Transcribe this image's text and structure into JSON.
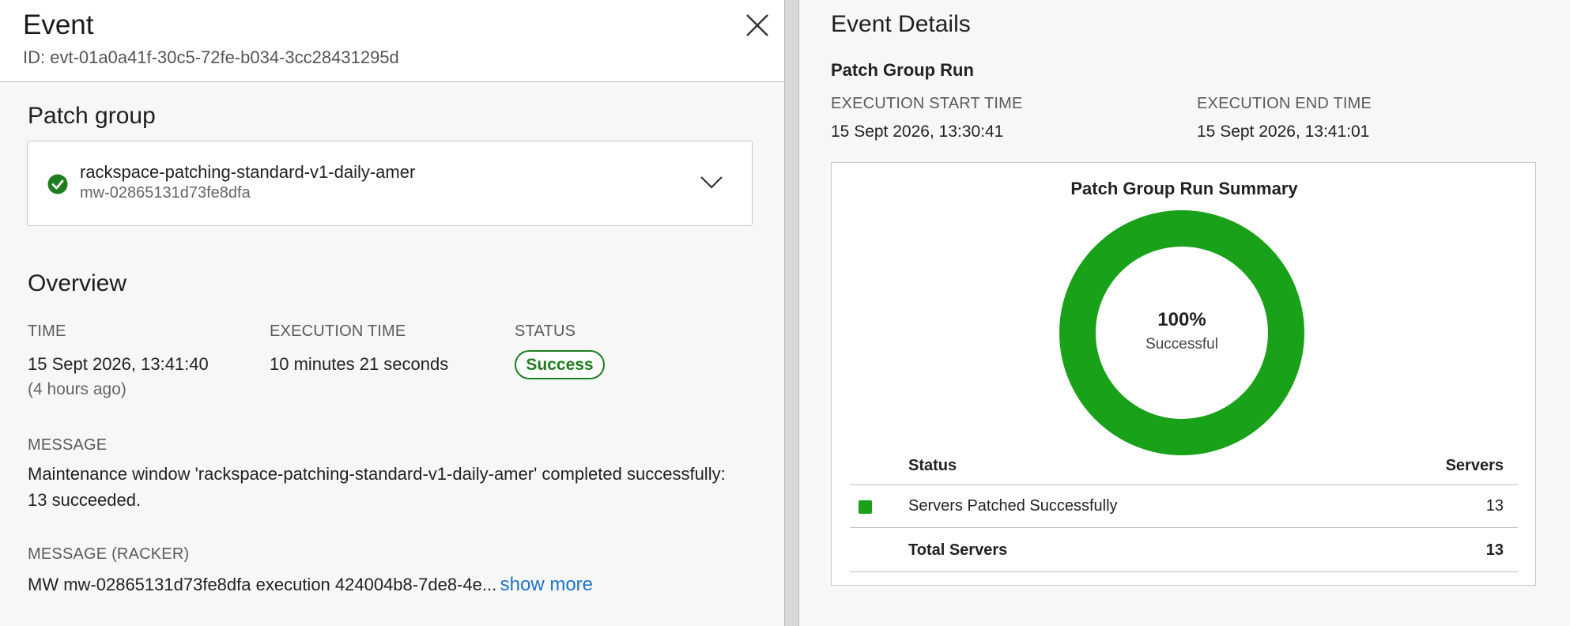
{
  "event": {
    "title": "Event",
    "id_text": "ID: evt-01a0a41f-30c5-72fe-b034-3cc28431295d"
  },
  "patch_group": {
    "section_title": "Patch group",
    "name": "rackspace-patching-standard-v1-daily-amer",
    "id": "mw-02865131d73fe8dfa",
    "status_icon": "check-circle-icon"
  },
  "overview": {
    "section_title": "Overview",
    "time_label": "TIME",
    "time_value": "15 Sept 2026, 13:41:40",
    "time_relative": "(4 hours ago)",
    "exec_label": "EXECUTION TIME",
    "exec_value": "10 minutes 21 seconds",
    "status_label": "STATUS",
    "status_value": "Success",
    "message_label": "MESSAGE",
    "message_value": "Maintenance window 'rackspace-patching-standard-v1-daily-amer' completed successfully: 13 succeeded.",
    "racker_label": "MESSAGE (RACKER)",
    "racker_value": "MW mw-02865131d73fe8dfa execution 424004b8-7de8-4e...",
    "show_more": "show more"
  },
  "details": {
    "title": "Event Details",
    "subtitle": "Patch Group Run",
    "start_label": "EXECUTION START TIME",
    "start_value": "15 Sept 2026, 13:30:41",
    "end_label": "EXECUTION END TIME",
    "end_value": "15 Sept 2026, 13:41:01"
  },
  "summary": {
    "title": "Patch Group Run Summary",
    "center_value": "100%",
    "center_label": "Successful",
    "col_status": "Status",
    "col_servers": "Servers",
    "rows": [
      {
        "status": "Servers Patched Successfully",
        "servers": "13"
      },
      {
        "status": "Total Servers",
        "servers": "13"
      }
    ]
  },
  "colors": {
    "success_green": "#1aa11a",
    "success_text": "#1e7d1e",
    "link_blue": "#1f74c7"
  },
  "chart_data": {
    "type": "pie",
    "categories": [
      "Servers Patched Successfully"
    ],
    "values": [
      13
    ],
    "title": "Patch Group Run Summary"
  }
}
